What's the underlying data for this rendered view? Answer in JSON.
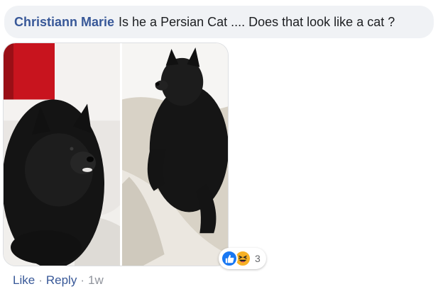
{
  "comment": {
    "author": "Christiann Marie",
    "text": "Is he a Persian Cat .... Does that look like a cat ?"
  },
  "photos": [
    {
      "subject": "black-pomeranian-dog-lying"
    },
    {
      "subject": "black-pomeranian-dog-on-pillows"
    }
  ],
  "reactions": {
    "icons": [
      "like-icon",
      "haha-icon"
    ],
    "count": "3",
    "colors": {
      "like": "#1877f2",
      "haha": "#f7b125"
    }
  },
  "actions": {
    "like_label": "Like",
    "separator": "·",
    "reply_label": "Reply",
    "timestamp": "1w"
  },
  "colors": {
    "author": "#385898",
    "bubble_bg": "#f0f2f5",
    "meta": "#90949c"
  }
}
